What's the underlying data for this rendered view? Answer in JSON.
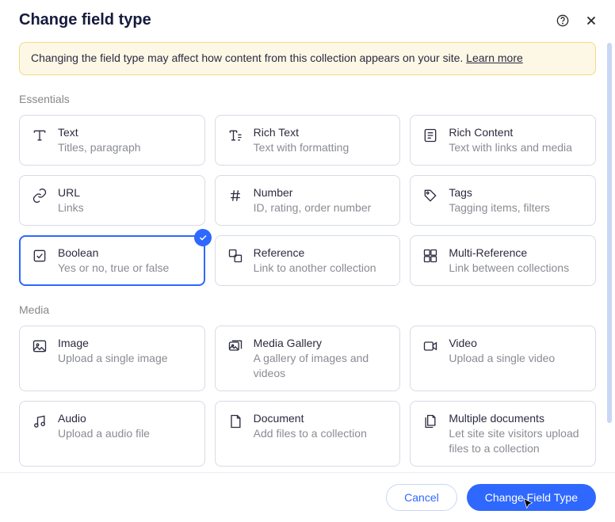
{
  "title": "Change field type",
  "banner": {
    "text_before": "Changing the field type may affect how content from this collection appears on your site. ",
    "link": "Learn more"
  },
  "sections": {
    "essentials": {
      "label": "Essentials"
    },
    "media": {
      "label": "Media"
    }
  },
  "fields": {
    "text": {
      "name": "Text",
      "desc": "Titles, paragraph"
    },
    "richText": {
      "name": "Rich Text",
      "desc": "Text with formatting"
    },
    "richContent": {
      "name": "Rich Content",
      "desc": "Text with links and media"
    },
    "url": {
      "name": "URL",
      "desc": "Links"
    },
    "number": {
      "name": "Number",
      "desc": "ID, rating, order number"
    },
    "tags": {
      "name": "Tags",
      "desc": "Tagging items, filters"
    },
    "boolean": {
      "name": "Boolean",
      "desc": "Yes or no, true or false",
      "selected": true
    },
    "reference": {
      "name": "Reference",
      "desc": "Link to another collection"
    },
    "multiRef": {
      "name": "Multi-Reference",
      "desc": "Link between collections"
    },
    "image": {
      "name": "Image",
      "desc": "Upload a single image"
    },
    "gallery": {
      "name": "Media Gallery",
      "desc": "A gallery of images and videos"
    },
    "video": {
      "name": "Video",
      "desc": "Upload a single video"
    },
    "audio": {
      "name": "Audio",
      "desc": "Upload a audio file"
    },
    "document": {
      "name": "Document",
      "desc": "Add files to a collection"
    },
    "multiDoc": {
      "name": "Multiple documents",
      "desc": "Let site site visitors upload files to a collection"
    }
  },
  "buttons": {
    "cancel": "Cancel",
    "confirm": "Change Field Type"
  }
}
